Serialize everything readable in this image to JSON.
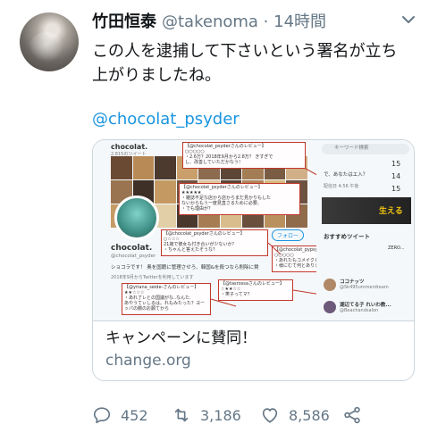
{
  "tweet": {
    "display_name": "竹田恒泰",
    "handle": "@takenoma",
    "separator": "·",
    "time": "14時間",
    "text_lines": [
      "この人を逮捕して下さいという署名が立ち",
      "上がりましたね。"
    ],
    "link": "@chocolat_psyder"
  },
  "card": {
    "title": "キャンペーンに賛同！",
    "domain": "change.org",
    "screenshot": {
      "account_name": "chocolat.",
      "account_name_small": "chocolat.",
      "handle": "@chocolat_psyder",
      "stats_text": "2,815のツイート",
      "bio": "ショコラです！ 奥を国籍に管理させろ、韓国&を殺つなら削除に賛",
      "joined": "2018年9月からTwitterを利用しています",
      "follow_label": "フォロー",
      "search_placeholder": "キーワード検索",
      "recommend_title": "おすすめツイート",
      "sidebar_question": "で、あなたはエ入？",
      "sidebar_date": "配信日 4:56 午後",
      "sidebar_numbers": [
        "15",
        "14",
        "15"
      ],
      "sidebar_user_1": "ココナッツ",
      "sidebar_user_1_handle": "@Sk495ummerdream",
      "sidebar_user_2": "湖辺てる子 れいわ教...",
      "sidebar_user_2_handle": "@Beachandsalon",
      "sidebar_banner_text": "ZERO...",
      "sidebar_banner_text_2": "生える",
      "review_boxes": [
        {
          "lines": [
            "【@chocolat_psyderさんのレビュー】",
            "○○○○○",
            "・2.6万？2018年9月から2.8万？ きすぎで",
            "し、改善していただかなう！"
          ]
        },
        {
          "lines": [
            "【@chocolat_psyderさんのレビュー】",
            "★★★★★",
            "・雑誌不足な店から店からまだ見かりもした",
            "ないからもう一度見直さるために必要、",
            "・でも理由が？"
          ]
        },
        {
          "lines": [
            "【@chocolat_psyderさんのレビュー】",
            "○☆☆☆",
            "21歳で彼女も付き合いが少ないか？",
            "・ちゃんと答えたそうな？"
          ]
        },
        {
          "lines": [
            "【@chocolat_pypsyさんのレビュー】",
            "○○○○○",
            "・あれたもコメイクと愛す！",
            "・様にむて何とありませんか!?"
          ]
        },
        {
          "lines": [
            "【@tasrossaさんのレビュー】",
            "☆★★☆☆",
            "・笑子ってマ？"
          ]
        },
        {
          "lines": [
            "【@yriana_seide-さんのレビュー】",
            "★★☆☆☆",
            "・あれ了レとの国議がな..なんた.",
            "あやうてぃしるは。れもみたった？ヨー",
            "ッパの腕のお願てから"
          ]
        }
      ]
    }
  },
  "actions": {
    "reply_count": "452",
    "retweet_count": "3,186",
    "like_count": "8,586"
  },
  "colors": {
    "text": "#14171a",
    "secondary": "#657786",
    "link": "#1b95e0",
    "border": "#ccd6dd"
  },
  "icons": {
    "reply": "reply-icon",
    "retweet": "retweet-icon",
    "like": "heart-icon",
    "share": "share-icon",
    "caret": "chevron-down-icon"
  }
}
